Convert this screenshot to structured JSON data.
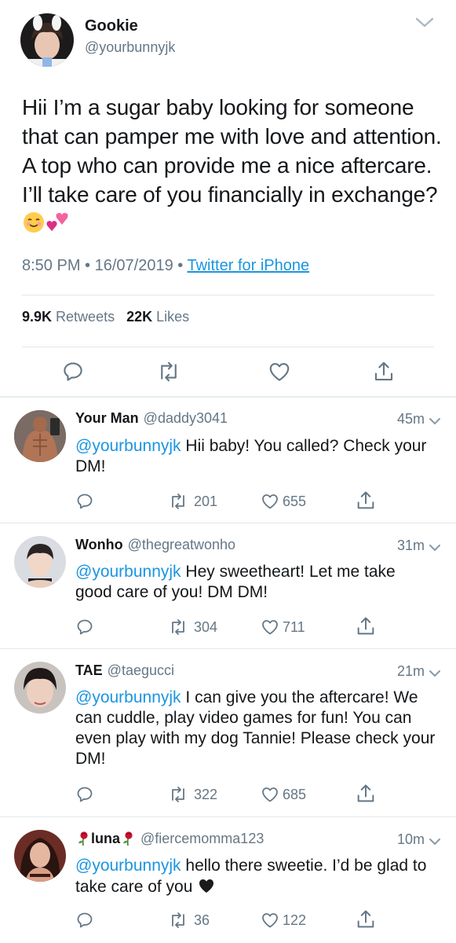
{
  "main_tweet": {
    "display_name": "Gookie",
    "handle": "@yourbunnyjk",
    "text": "Hii I’m a sugar baby looking for someone that can pamper me with love and attention. A top who can provide me a nice aftercare. I’ll take care of you financially in exchange?",
    "time": "8:50 PM",
    "date": "16/07/2019",
    "source": "Twitter for iPhone",
    "retweets_count": "9.9K",
    "retweets_label": "Retweets",
    "likes_count": "22K",
    "likes_label": "Likes"
  },
  "replies": [
    {
      "display_name": "Your Man",
      "handle": "@daddy3041",
      "time": "45m",
      "mention": "@yourbunnyjk",
      "text": " Hii baby! You called? Check your DM!",
      "retweets": "201",
      "likes": "655"
    },
    {
      "display_name": "Wonho",
      "handle": "@thegreatwonho",
      "time": "31m",
      "mention": "@yourbunnyjk",
      "text": " Hey sweetheart! Let me take good care of you! DM DM!",
      "retweets": "304",
      "likes": "711"
    },
    {
      "display_name": "TAE",
      "handle": "@taegucci",
      "time": "21m",
      "mention": "@yourbunnyjk",
      "text": " I can give you the aftercare! We can cuddle, play video games for fun! You can even play with my dog Tannie! Please check your DM!",
      "retweets": "322",
      "likes": "685"
    },
    {
      "display_name": "luna",
      "handle": "@fiercemomma123",
      "time": "10m",
      "mention": "@yourbunnyjk",
      "text": " hello there sweetie. I’d be glad to take care of you",
      "retweets": "36",
      "likes": "122"
    }
  ],
  "colors": {
    "link": "#1b95e0",
    "secondary_text": "#657786",
    "divider": "#e1e8ed"
  },
  "icons": [
    "chevron-down-icon",
    "reply-icon",
    "retweet-icon",
    "like-icon",
    "share-icon",
    "smiling-face-emoji",
    "two-hearts-emoji",
    "black-heart-emoji",
    "rose-emoji"
  ]
}
